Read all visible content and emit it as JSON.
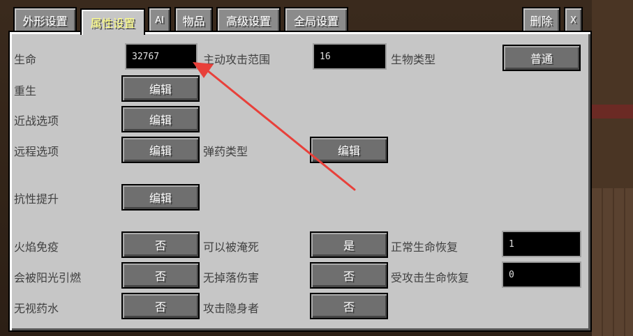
{
  "tabs": {
    "appearance": "外形设置",
    "attributes": "属性设置",
    "ai": "AI",
    "items": "物品",
    "advanced": "高级设置",
    "global": "全局设置",
    "delete": "删除",
    "close": "X"
  },
  "rows": {
    "health": {
      "label": "生命",
      "value": "32767"
    },
    "aggro_range": {
      "label": "主动攻击范围",
      "value": "16"
    },
    "creature_type": {
      "label": "生物类型",
      "button": "普通"
    },
    "respawn": {
      "label": "重生",
      "button": "编辑"
    },
    "melee": {
      "label": "近战选项",
      "button": "编辑"
    },
    "ranged": {
      "label": "远程选项",
      "button": "编辑"
    },
    "ammo_type": {
      "label": "弹药类型",
      "button": "编辑"
    },
    "resistance": {
      "label": "抗性提升",
      "button": "编辑"
    },
    "fire_immune": {
      "label": "火焰免疫",
      "button": "否"
    },
    "drownable": {
      "label": "可以被淹死",
      "button": "是"
    },
    "regen_normal": {
      "label": "正常生命恢复",
      "value": "1"
    },
    "sun_burn": {
      "label": "会被阳光引燃",
      "button": "否"
    },
    "no_fall_damage": {
      "label": "无掉落伤害",
      "button": "否"
    },
    "regen_combat": {
      "label": "受攻击生命恢复",
      "value": "0"
    },
    "ignore_potions": {
      "label": "无视药水",
      "button": "否"
    },
    "attack_invisible": {
      "label": "攻击隐身者",
      "button": "否"
    }
  },
  "colors": {
    "annotation_arrow": "#e8403a",
    "active_tab_text": "#ffff7f"
  },
  "annotation": {
    "icon": "red-arrow-icon"
  }
}
